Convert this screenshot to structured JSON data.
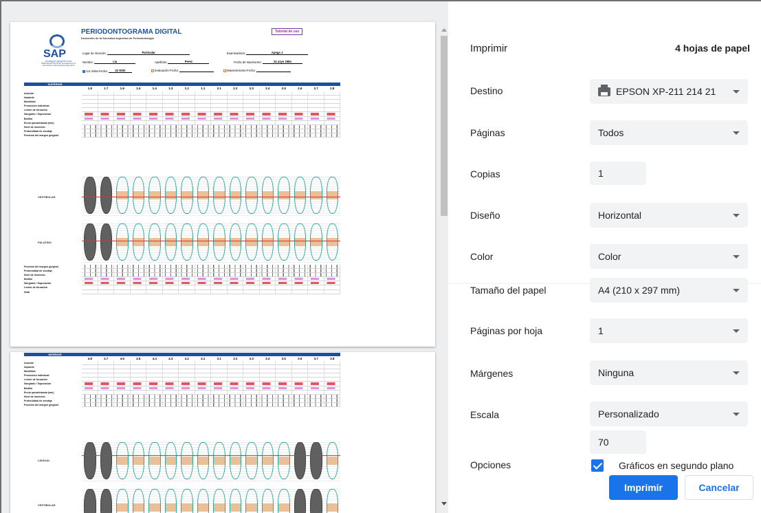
{
  "preview": {
    "doc": {
      "title": "PERIODONTOGRAMA DIGITAL",
      "subtitle": "Desarrollo de la Sociedad Argentina de Periodontología",
      "tutorial": "Tutorial de uso",
      "logo_text": "SAP",
      "logo_sub": "SOCIEDAD ARGENTINA DE PERIODONTOLOGÍA Sociedad de la Asociación Odontológica Argentina",
      "lugar_label": "Lugar de Atención:",
      "lugar_value": "Particular",
      "examinador_label": "Examinador/a:",
      "examinador_value": "Apego J",
      "nombre_label": "Nombre:",
      "nombre_value": "Lia",
      "apellidos_label": "Apellidos:",
      "apellidos_value": "Perez",
      "nacimiento_label": "Fecha de Nacimiento:",
      "nacimiento_value": "24 a1yo 1984",
      "visita_label": "1ra Visita-Fecha:",
      "visita_value": "22 /6/20",
      "evaluacion_label": "Evaluación-Fecha:",
      "mantenimiento_label": "Mantenimiento-Fecha:"
    },
    "superior": {
      "banner": "SUPERIOR",
      "teeth": [
        "1.8",
        "1.7",
        "1.6",
        "1.5",
        "1.4",
        "1.3",
        "1.2",
        "1.1",
        "2.1",
        "2.2",
        "2.3",
        "2.4",
        "2.5",
        "2.6",
        "2.7",
        "2.8"
      ],
      "rows": [
        "Ausente",
        "Implante",
        "Movilidad",
        "Pronóstico individual",
        "Lesión de furcación",
        "Sangrado / Supuración",
        "Biofilm",
        "Encía queratinizada (mm)",
        "Nivel de inserción",
        "Profundidad de sondaje",
        "Posición del margen gingival"
      ],
      "vestibular": "VESTIBULAR",
      "palatino": "PALATINO",
      "rows_bottom": [
        "Posición del margen gingival",
        "Profundidad de sondaje",
        "Nivel de inserción",
        "Biofilm",
        "Sangrado / Supuración",
        "Lesión de furcación",
        "Nota"
      ]
    },
    "inferior": {
      "banner": "INFERIOR",
      "teeth": [
        "4.8",
        "4.7",
        "4.6",
        "4.5",
        "4.4",
        "4.3",
        "4.2",
        "4.1",
        "3.1",
        "3.2",
        "3.3",
        "3.4",
        "3.5",
        "3.6",
        "3.7",
        "3.8"
      ],
      "rows": [
        "Ausente",
        "Implante",
        "Movilidad",
        "Pronóstico individual",
        "Lesión de furcación",
        "Sangrado / Supuración",
        "Biofilm",
        "Encía queratinizada (mm)",
        "Nivel de inserción",
        "Profundidad de sondaje",
        "Posición del margen gingival"
      ],
      "lingual": "LINGUAL",
      "vestibular": "VESTIBULAR"
    }
  },
  "panel": {
    "title": "Imprimir",
    "sheets": "4 hojas de papel",
    "destino_label": "Destino",
    "destino_value": "EPSON XP-211 214 21",
    "paginas_label": "Páginas",
    "paginas_value": "Todos",
    "copias_label": "Copias",
    "copias_value": "1",
    "diseno_label": "Diseño",
    "diseno_value": "Horizontal",
    "color_label": "Color",
    "color_value": "Color",
    "tamano_label": "Tamaño del papel",
    "tamano_value": "A4 (210 x 297 mm)",
    "pph_label": "Páginas por hoja",
    "pph_value": "1",
    "margenes_label": "Márgenes",
    "margenes_value": "Ninguna",
    "escala_label": "Escala",
    "escala_value": "Personalizado",
    "escala_custom": "70",
    "opciones_label": "Opciones",
    "graficos_label": "Gráficos en segundo plano",
    "print_button": "Imprimir",
    "cancel_button": "Cancelar"
  },
  "colors": {
    "accent": "#1a73e8",
    "doc_blue": "#1e4f9c"
  }
}
